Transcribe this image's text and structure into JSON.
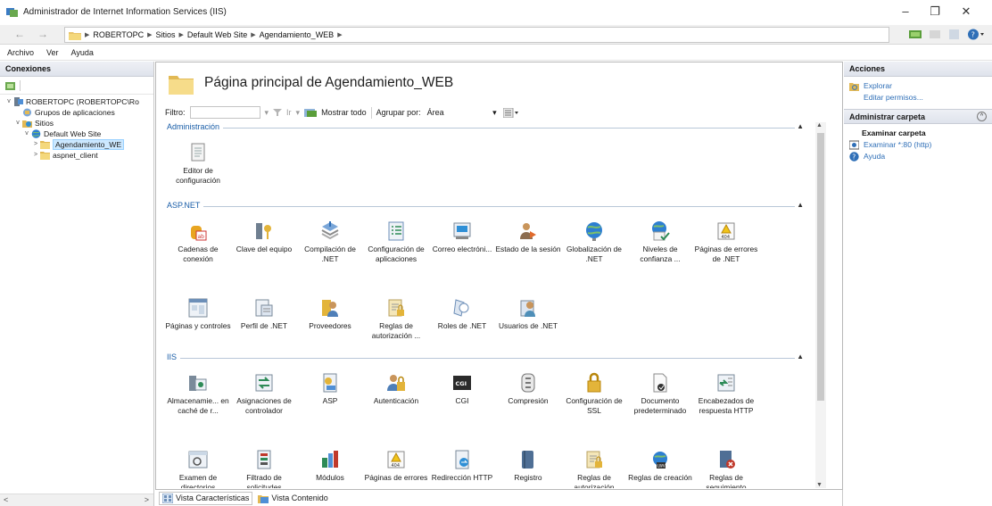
{
  "window": {
    "title": "Administrador de Internet Information Services (IIS)",
    "controls": {
      "minimize": "–",
      "maximize": "❐",
      "close": "✕"
    }
  },
  "address": {
    "back": "←",
    "forward": "→",
    "crumbs": [
      "ROBERTOPC",
      "Sitios",
      "Default Web Site",
      "Agendamiento_WEB"
    ]
  },
  "menu": [
    "Archivo",
    "Ver",
    "Ayuda"
  ],
  "connections": {
    "title": "Conexiones",
    "tree": [
      {
        "label": "ROBERTOPC (ROBERTOPC\\Ro",
        "level": 0,
        "expander": "v",
        "icon": "server"
      },
      {
        "label": "Grupos de aplicaciones",
        "level": 1,
        "expander": "",
        "icon": "apppool"
      },
      {
        "label": "Sitios",
        "level": 1,
        "expander": "v",
        "icon": "sites"
      },
      {
        "label": "Default Web Site",
        "level": 2,
        "expander": "v",
        "icon": "globe"
      },
      {
        "label": "Agendamiento_WE",
        "level": 3,
        "expander": ">",
        "icon": "folder",
        "selected": true
      },
      {
        "label": "aspnet_client",
        "level": 3,
        "expander": ">",
        "icon": "folder"
      }
    ],
    "scroll_left": "<",
    "scroll_right": ">"
  },
  "page": {
    "title": "Página principal de Agendamiento_WEB",
    "filter_label": "Filtro:",
    "go_label": "Ir",
    "show_all_label": "Mostrar todo",
    "group_by_label": "Agrupar por:",
    "group_by_value": "Área"
  },
  "groups": [
    {
      "name": "Administración",
      "features": [
        {
          "label": "Editor de configuración",
          "icon": "config-editor"
        }
      ]
    },
    {
      "name": "ASP.NET",
      "features": [
        {
          "label": "Cadenas de conexión",
          "icon": "connection-strings"
        },
        {
          "label": "Clave del equipo",
          "icon": "machine-key"
        },
        {
          "label": "Compilación de .NET",
          "icon": "compilation"
        },
        {
          "label": "Configuración de aplicaciones",
          "icon": "app-settings"
        },
        {
          "label": "Correo electróni...",
          "icon": "smtp"
        },
        {
          "label": "Estado de la sesión",
          "icon": "session-state"
        },
        {
          "label": "Globalización de .NET",
          "icon": "globalization"
        },
        {
          "label": "Niveles de confianza ...",
          "icon": "trust-levels"
        },
        {
          "label": "Páginas de errores de .NET",
          "icon": "error-pages-net"
        },
        {
          "label": "Páginas y controles",
          "icon": "pages-controls"
        },
        {
          "label": "Perfil de .NET",
          "icon": "profile"
        },
        {
          "label": "Proveedores",
          "icon": "providers"
        },
        {
          "label": "Reglas de autorización ...",
          "icon": "authorization-net"
        },
        {
          "label": "Roles de .NET",
          "icon": "roles"
        },
        {
          "label": "Usuarios de .NET",
          "icon": "users"
        }
      ]
    },
    {
      "name": "IIS",
      "features": [
        {
          "label": "Almacenamie... en caché de r...",
          "icon": "output-cache"
        },
        {
          "label": "Asignaciones de controlador",
          "icon": "handler-mappings"
        },
        {
          "label": "ASP",
          "icon": "asp"
        },
        {
          "label": "Autenticación",
          "icon": "authentication"
        },
        {
          "label": "CGI",
          "icon": "cgi"
        },
        {
          "label": "Compresión",
          "icon": "compression"
        },
        {
          "label": "Configuración de SSL",
          "icon": "ssl"
        },
        {
          "label": "Documento predeterminado",
          "icon": "default-document"
        },
        {
          "label": "Encabezados de respuesta HTTP",
          "icon": "http-headers"
        },
        {
          "label": "Examen de directorios",
          "icon": "directory-browsing"
        },
        {
          "label": "Filtrado de solicitudes",
          "icon": "request-filtering"
        },
        {
          "label": "Módulos",
          "icon": "modules"
        },
        {
          "label": "Páginas de errores",
          "icon": "error-pages"
        },
        {
          "label": "Redirección HTTP",
          "icon": "http-redirect"
        },
        {
          "label": "Registro",
          "icon": "logging"
        },
        {
          "label": "Reglas de autorización",
          "icon": "authorization"
        },
        {
          "label": "Reglas de creación",
          "icon": "rewrite-rules"
        },
        {
          "label": "Reglas de seguimiento",
          "icon": "tracing-rules"
        }
      ]
    }
  ],
  "bottom_tabs": {
    "features_view": "Vista Características",
    "content_view": "Vista Contenido"
  },
  "actions": {
    "title": "Acciones",
    "items_top": [
      {
        "label": "Explorar",
        "icon": "explore"
      },
      {
        "label": "Editar permisos...",
        "icon": ""
      }
    ],
    "section": "Administrar carpeta",
    "section_toggle": "^",
    "section_heading": "Examinar carpeta",
    "browse_item": "Examinar *:80 (http)",
    "help": "Ayuda"
  }
}
